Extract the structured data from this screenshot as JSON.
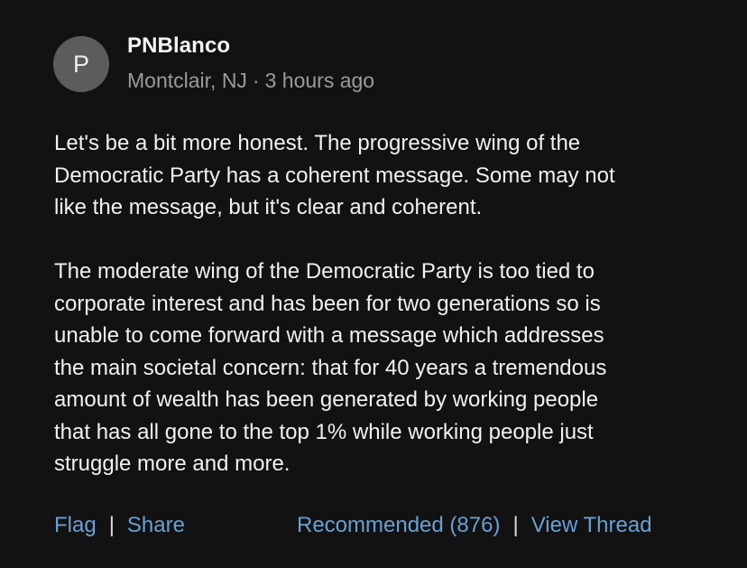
{
  "comment": {
    "avatar_initial": "P",
    "author": "PNBlanco",
    "location": "Montclair, NJ",
    "separator": "·",
    "time": "3 hours ago",
    "paragraphs": [
      "Let's be a bit more honest. The progressive wing of the\nDemocratic Party has a coherent message. Some may not\nlike the message, but it's clear and coherent.",
      "The moderate wing of the Democratic Party is too tied to\ncorporate interest and has been for two generations so is\nunable to come forward with a message which addresses\nthe main societal concern: that for 40 years a tremendous\namount of wealth has been generated by working people\nthat has all gone to the top 1% while working people just\nstruggle more and more."
    ]
  },
  "actions": {
    "flag_label": "Flag",
    "share_label": "Share",
    "recommended_label": "Recommended (876)",
    "view_thread_label": "View Thread",
    "divider": "|"
  },
  "colors": {
    "background": "#121212",
    "link": "#6a9fd6",
    "meta": "#9b9b9b",
    "avatar": "#5c5c5c"
  }
}
